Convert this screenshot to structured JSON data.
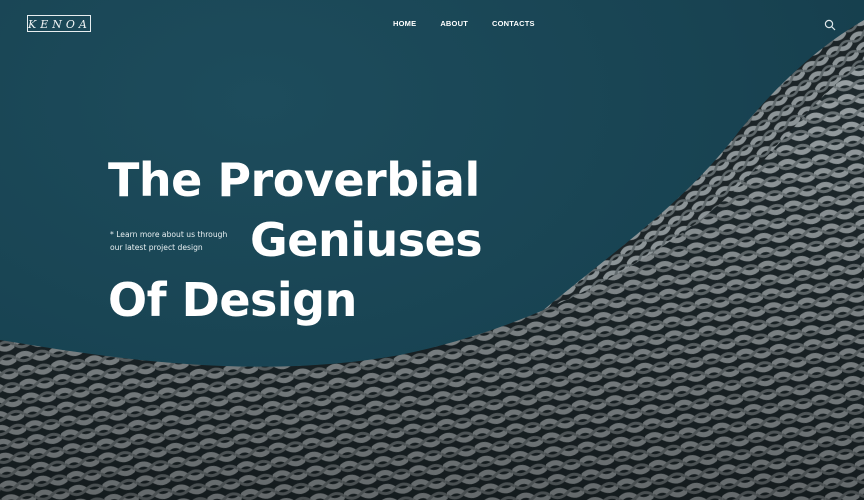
{
  "brand": {
    "logo_text": "KENOA"
  },
  "nav": {
    "items": [
      {
        "label": "HOME"
      },
      {
        "label": "ABOUT"
      },
      {
        "label": "CONTACTS"
      }
    ],
    "search_icon": "search-icon"
  },
  "hero": {
    "title_line1": "The Proverbial",
    "title_line2": "Geniuses",
    "title_line3": "Of Design",
    "note_line1": "* Learn more about us through",
    "note_line2": "our latest project design"
  },
  "colors": {
    "sky": "#1a4656",
    "facade": "#8a9295",
    "text": "#ffffff"
  }
}
